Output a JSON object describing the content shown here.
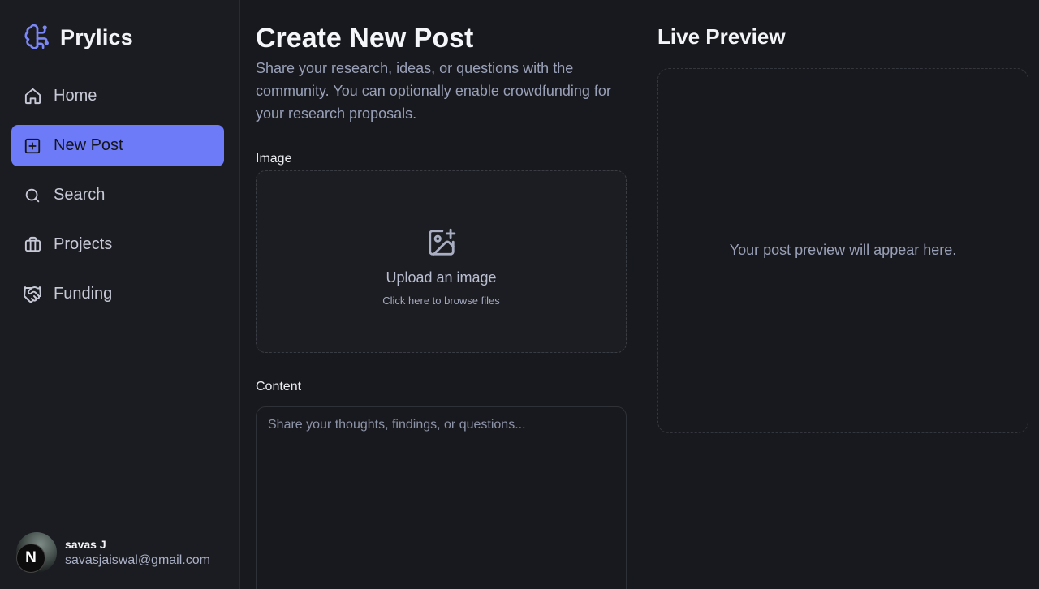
{
  "app": {
    "name": "Prylics",
    "accent": "#6e7bf8"
  },
  "sidebar": {
    "items": [
      {
        "label": "Home",
        "icon": "home-icon",
        "active": false
      },
      {
        "label": "New Post",
        "icon": "plus-square-icon",
        "active": true
      },
      {
        "label": "Search",
        "icon": "search-icon",
        "active": false
      },
      {
        "label": "Projects",
        "icon": "briefcase-icon",
        "active": false
      },
      {
        "label": "Funding",
        "icon": "handshake-icon",
        "active": false
      }
    ]
  },
  "user": {
    "name": "savas J",
    "email": "savasjaiswal@gmail.com",
    "avatar_badge": "N"
  },
  "main": {
    "title": "Create New Post",
    "description": "Share your research, ideas, or questions with the community. You can optionally enable crowdfunding for your research proposals.",
    "image_label": "Image",
    "upload_title": "Upload an image",
    "upload_subtitle": "Click here to browse files",
    "content_label": "Content",
    "content_placeholder": "Share your thoughts, findings, or questions..."
  },
  "preview": {
    "title": "Live Preview",
    "placeholder": "Your post preview will appear here."
  }
}
